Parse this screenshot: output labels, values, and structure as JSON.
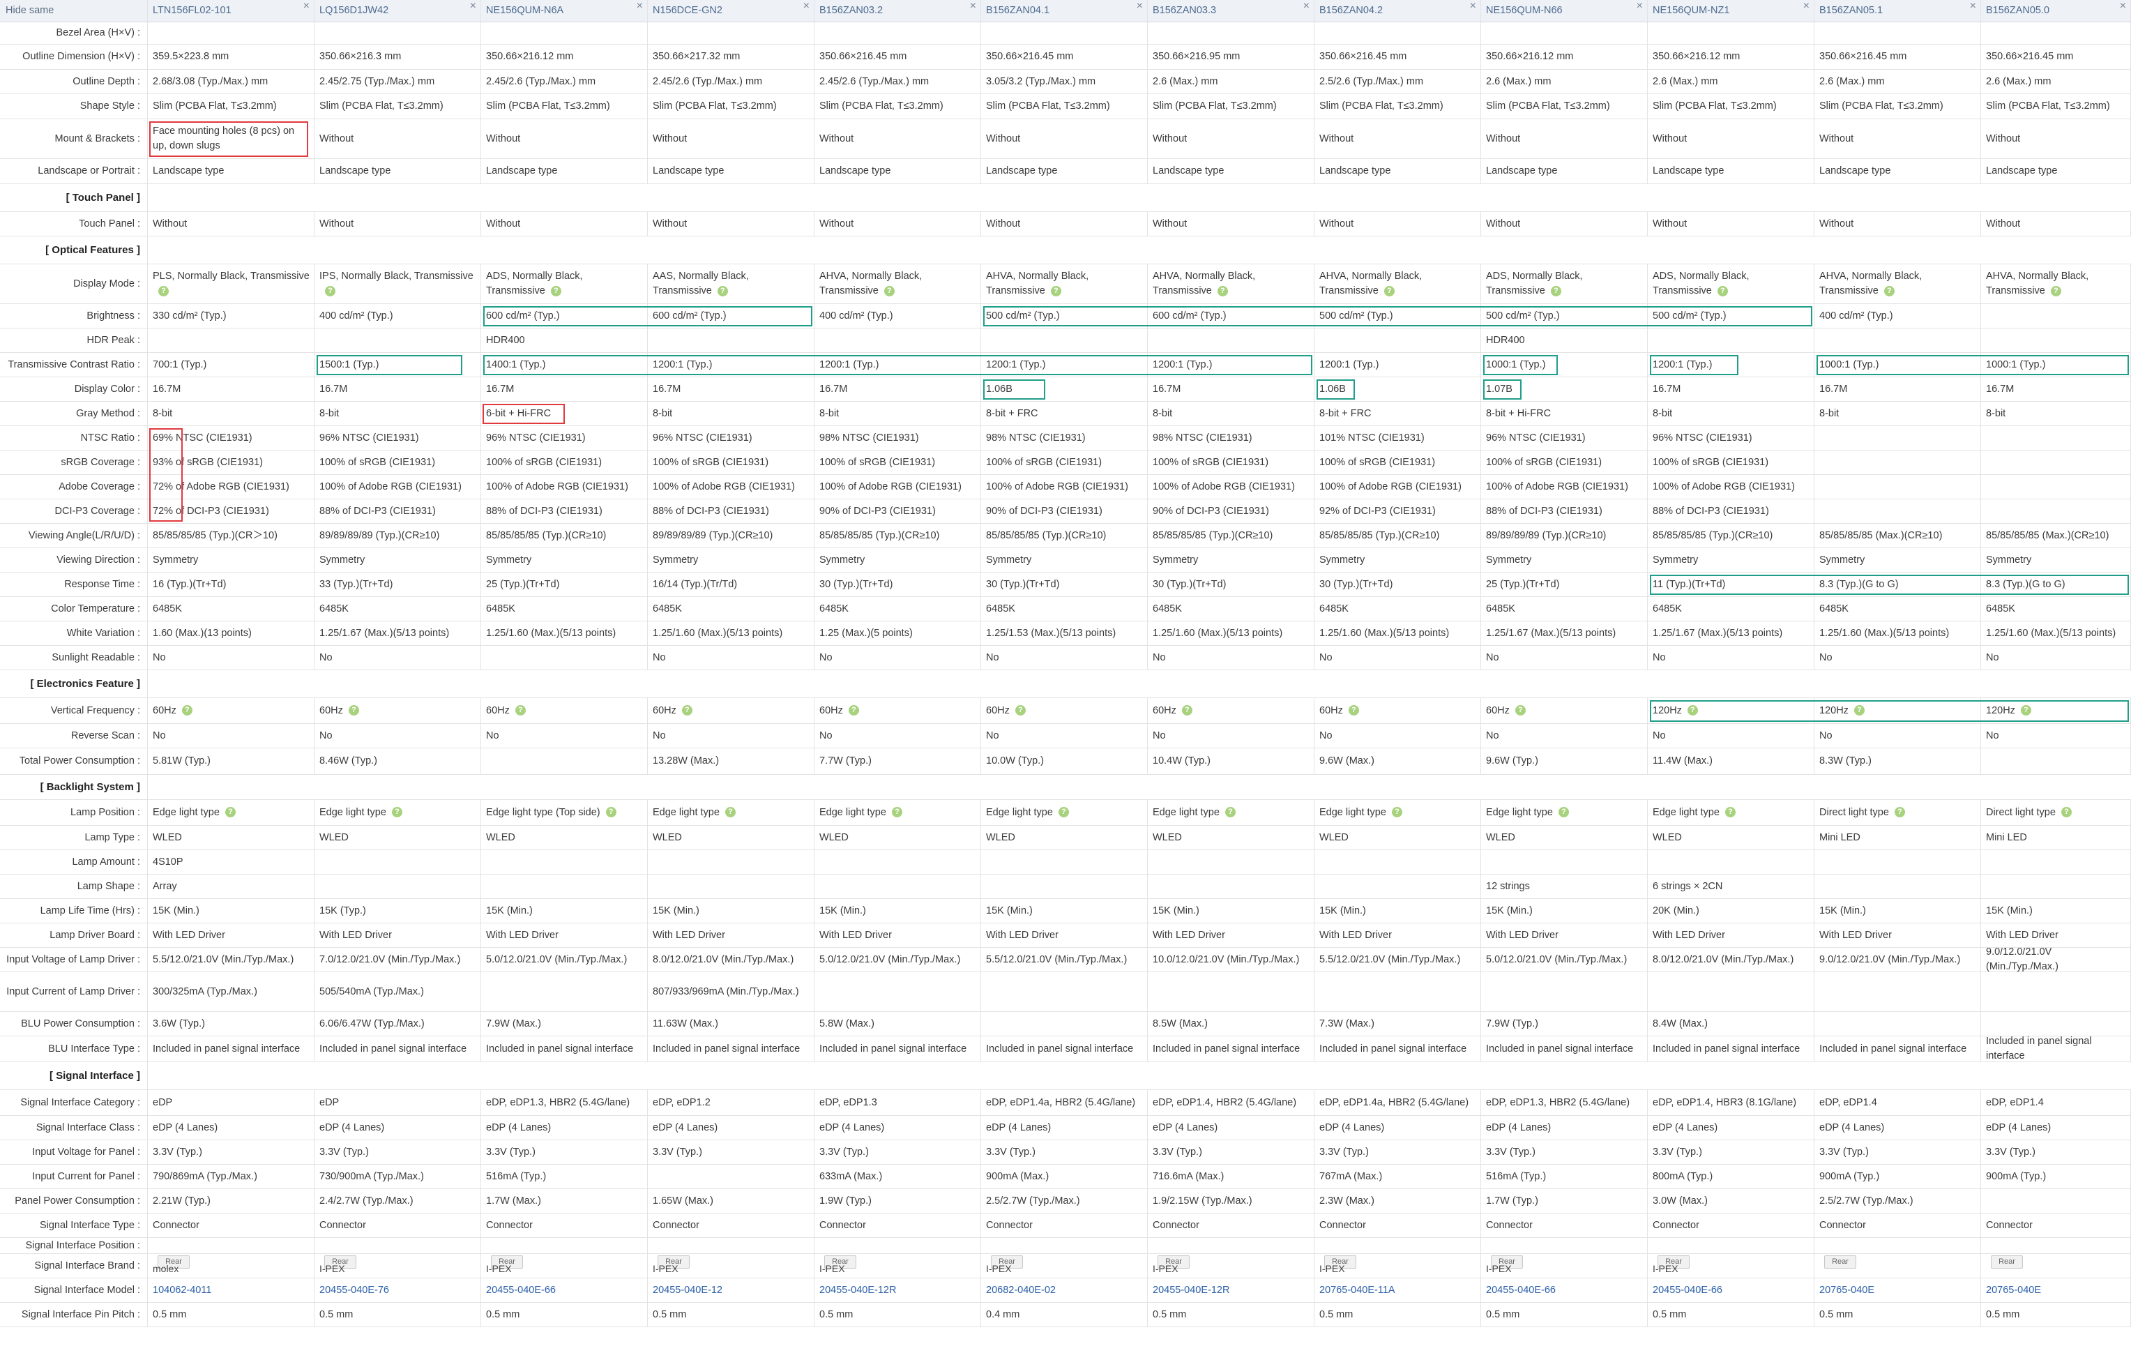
{
  "header": {
    "label": "Hide same",
    "models": [
      "LTN156FL02-101",
      "LQ156D1JW42",
      "NE156QUM-N6A",
      "N156DCE-GN2",
      "B156ZAN03.2",
      "B156ZAN04.1",
      "B156ZAN03.3",
      "B156ZAN04.2",
      "NE156QUM-N66",
      "NE156QUM-NZ1",
      "B156ZAN05.1",
      "B156ZAN05.0"
    ],
    "close_glyph": "×"
  },
  "rows": [
    {
      "label": "Bezel Area (H×V) :",
      "values": [
        "",
        "",
        "",
        "",
        "",
        "",
        "",
        "",
        "",
        "",
        "",
        ""
      ]
    },
    {
      "label": "Outline Dimension (H×V) :",
      "values": [
        "359.5×223.8 mm",
        "350.66×216.3 mm",
        "350.66×216.12 mm",
        "350.66×217.32 mm",
        "350.66×216.45 mm",
        "350.66×216.45 mm",
        "350.66×216.95 mm",
        "350.66×216.45 mm",
        "350.66×216.12 mm",
        "350.66×216.12 mm",
        "350.66×216.45 mm",
        "350.66×216.45 mm"
      ]
    },
    {
      "label": "Outline Depth :",
      "values": [
        "2.68/3.08 (Typ./Max.) mm",
        "2.45/2.75 (Typ./Max.) mm",
        "2.45/2.6 (Typ./Max.) mm",
        "2.45/2.6 (Typ./Max.) mm",
        "2.45/2.6 (Typ./Max.) mm",
        "3.05/3.2 (Typ./Max.) mm",
        "2.6 (Max.) mm",
        "2.5/2.6 (Typ./Max.) mm",
        "2.6 (Max.) mm",
        "2.6 (Max.) mm",
        "2.6 (Max.) mm",
        "2.6 (Max.) mm"
      ]
    },
    {
      "label": "Shape Style :",
      "values": [
        "Slim (PCBA Flat, T≤3.2mm)",
        "Slim (PCBA Flat, T≤3.2mm)",
        "Slim (PCBA Flat, T≤3.2mm)",
        "Slim (PCBA Flat, T≤3.2mm)",
        "Slim (PCBA Flat, T≤3.2mm)",
        "Slim (PCBA Flat, T≤3.2mm)",
        "Slim (PCBA Flat, T≤3.2mm)",
        "Slim (PCBA Flat, T≤3.2mm)",
        "Slim (PCBA Flat, T≤3.2mm)",
        "Slim (PCBA Flat, T≤3.2mm)",
        "Slim (PCBA Flat, T≤3.2mm)",
        "Slim (PCBA Flat, T≤3.2mm)"
      ]
    },
    {
      "label": "Mount & Brackets :",
      "values": [
        "Face mounting holes (8 pcs) on up, down slugs",
        "Without",
        "Without",
        "Without",
        "Without",
        "Without",
        "Without",
        "Without",
        "Without",
        "Without",
        "Without",
        "Without"
      ]
    },
    {
      "label": "Landscape or Portrait :",
      "values": [
        "Landscape type",
        "Landscape type",
        "Landscape type",
        "Landscape type",
        "Landscape type",
        "Landscape type",
        "Landscape type",
        "Landscape type",
        "Landscape type",
        "Landscape type",
        "Landscape type",
        "Landscape type"
      ]
    },
    {
      "section": "[ Touch Panel ]"
    },
    {
      "label": "Touch Panel :",
      "values": [
        "Without",
        "Without",
        "Without",
        "Without",
        "Without",
        "Without",
        "Without",
        "Without",
        "Without",
        "Without",
        "Without",
        "Without"
      ]
    },
    {
      "section": "[ Optical Features ]"
    },
    {
      "label": "Display Mode :",
      "help": true,
      "values": [
        "PLS, Normally Black, Transmissive",
        "IPS, Normally Black, Transmissive",
        "ADS, Normally Black, Transmissive",
        "AAS, Normally Black, Transmissive",
        "AHVA, Normally Black, Transmissive",
        "AHVA, Normally Black, Transmissive",
        "AHVA, Normally Black, Transmissive",
        "AHVA, Normally Black, Transmissive",
        "ADS, Normally Black, Transmissive",
        "ADS, Normally Black, Transmissive",
        "AHVA, Normally Black, Transmissive",
        "AHVA, Normally Black, Transmissive"
      ]
    },
    {
      "label": "Brightness :",
      "values": [
        "330 cd/m² (Typ.)",
        "400 cd/m² (Typ.)",
        "600 cd/m² (Typ.)",
        "600 cd/m² (Typ.)",
        "400 cd/m² (Typ.)",
        "500 cd/m² (Typ.)",
        "600 cd/m² (Typ.)",
        "500 cd/m² (Typ.)",
        "500 cd/m² (Typ.)",
        "500 cd/m² (Typ.)",
        "400 cd/m² (Typ.)",
        ""
      ]
    },
    {
      "label": "HDR Peak :",
      "values": [
        "",
        "",
        "HDR400",
        "",
        "",
        "",
        "",
        "",
        "HDR400",
        "",
        "",
        ""
      ]
    },
    {
      "label": "Transmissive Contrast Ratio :",
      "values": [
        "700:1 (Typ.)",
        "1500:1 (Typ.)",
        "1400:1 (Typ.)",
        "1200:1 (Typ.)",
        "1200:1 (Typ.)",
        "1200:1 (Typ.)",
        "1200:1 (Typ.)",
        "1200:1 (Typ.)",
        "1000:1 (Typ.)",
        "1200:1 (Typ.)",
        "1000:1 (Typ.)",
        "1000:1 (Typ.)"
      ]
    },
    {
      "label": "Display Color :",
      "values": [
        "16.7M",
        "16.7M",
        "16.7M",
        "16.7M",
        "16.7M",
        "1.06B",
        "16.7M",
        "1.06B",
        "1.07B",
        "16.7M",
        "16.7M",
        "16.7M"
      ]
    },
    {
      "label": "Gray Method :",
      "values": [
        "8-bit",
        "8-bit",
        "6-bit + Hi-FRC",
        "8-bit",
        "8-bit",
        "8-bit + FRC",
        "8-bit",
        "8-bit + FRC",
        "8-bit + Hi-FRC",
        "8-bit",
        "8-bit",
        "8-bit"
      ]
    },
    {
      "label": "NTSC Ratio :",
      "values": [
        "69% NTSC (CIE1931)",
        "96% NTSC (CIE1931)",
        "96% NTSC (CIE1931)",
        "96% NTSC (CIE1931)",
        "98% NTSC (CIE1931)",
        "98% NTSC (CIE1931)",
        "98% NTSC (CIE1931)",
        "101% NTSC (CIE1931)",
        "96% NTSC (CIE1931)",
        "96% NTSC (CIE1931)",
        "",
        ""
      ]
    },
    {
      "label": "sRGB Coverage :",
      "values": [
        "93% of sRGB (CIE1931)",
        "100% of sRGB (CIE1931)",
        "100% of sRGB (CIE1931)",
        "100% of sRGB (CIE1931)",
        "100% of sRGB (CIE1931)",
        "100% of sRGB (CIE1931)",
        "100% of sRGB (CIE1931)",
        "100% of sRGB (CIE1931)",
        "100% of sRGB (CIE1931)",
        "100% of sRGB (CIE1931)",
        "",
        ""
      ]
    },
    {
      "label": "Adobe Coverage :",
      "values": [
        "72% of Adobe RGB (CIE1931)",
        "100% of Adobe RGB (CIE1931)",
        "100% of Adobe RGB (CIE1931)",
        "100% of Adobe RGB (CIE1931)",
        "100% of Adobe RGB (CIE1931)",
        "100% of Adobe RGB (CIE1931)",
        "100% of Adobe RGB (CIE1931)",
        "100% of Adobe RGB (CIE1931)",
        "100% of Adobe RGB (CIE1931)",
        "100% of Adobe RGB (CIE1931)",
        "",
        ""
      ]
    },
    {
      "label": "DCI-P3 Coverage :",
      "values": [
        "72% of DCI-P3 (CIE1931)",
        "88% of DCI-P3 (CIE1931)",
        "88% of DCI-P3 (CIE1931)",
        "88% of DCI-P3 (CIE1931)",
        "90% of DCI-P3 (CIE1931)",
        "90% of DCI-P3 (CIE1931)",
        "90% of DCI-P3 (CIE1931)",
        "92% of DCI-P3 (CIE1931)",
        "88% of DCI-P3 (CIE1931)",
        "88% of DCI-P3 (CIE1931)",
        "",
        ""
      ]
    },
    {
      "label": "Viewing Angle(L/R/U/D) :",
      "values": [
        "85/85/85/85 (Typ.)(CR＞10)",
        "89/89/89/89 (Typ.)(CR≥10)",
        "85/85/85/85 (Typ.)(CR≥10)",
        "89/89/89/89 (Typ.)(CR≥10)",
        "85/85/85/85 (Typ.)(CR≥10)",
        "85/85/85/85 (Typ.)(CR≥10)",
        "85/85/85/85 (Typ.)(CR≥10)",
        "85/85/85/85 (Typ.)(CR≥10)",
        "89/89/89/89 (Typ.)(CR≥10)",
        "85/85/85/85 (Typ.)(CR≥10)",
        "85/85/85/85 (Max.)(CR≥10)",
        "85/85/85/85 (Max.)(CR≥10)"
      ]
    },
    {
      "label": "Viewing Direction :",
      "values": [
        "Symmetry",
        "Symmetry",
        "Symmetry",
        "Symmetry",
        "Symmetry",
        "Symmetry",
        "Symmetry",
        "Symmetry",
        "Symmetry",
        "Symmetry",
        "Symmetry",
        "Symmetry"
      ]
    },
    {
      "label": "Response Time :",
      "values": [
        "16 (Typ.)(Tr+Td)",
        "33 (Typ.)(Tr+Td)",
        "25 (Typ.)(Tr+Td)",
        "16/14 (Typ.)(Tr/Td)",
        "30 (Typ.)(Tr+Td)",
        "30 (Typ.)(Tr+Td)",
        "30 (Typ.)(Tr+Td)",
        "30 (Typ.)(Tr+Td)",
        "25 (Typ.)(Tr+Td)",
        "11 (Typ.)(Tr+Td)",
        "8.3 (Typ.)(G to G)",
        "8.3 (Typ.)(G to G)"
      ]
    },
    {
      "label": "Color Temperature :",
      "values": [
        "6485K",
        "6485K",
        "6485K",
        "6485K",
        "6485K",
        "6485K",
        "6485K",
        "6485K",
        "6485K",
        "6485K",
        "6485K",
        "6485K"
      ]
    },
    {
      "label": "White Variation :",
      "values": [
        "1.60 (Max.)(13 points)",
        "1.25/1.67 (Max.)(5/13 points)",
        "1.25/1.60 (Max.)(5/13 points)",
        "1.25/1.60 (Max.)(5/13 points)",
        "1.25 (Max.)(5 points)",
        "1.25/1.53 (Max.)(5/13 points)",
        "1.25/1.60 (Max.)(5/13 points)",
        "1.25/1.60 (Max.)(5/13 points)",
        "1.25/1.67 (Max.)(5/13 points)",
        "1.25/1.67 (Max.)(5/13 points)",
        "1.25/1.60 (Max.)(5/13 points)",
        "1.25/1.60 (Max.)(5/13 points)"
      ]
    },
    {
      "label": "Sunlight Readable :",
      "values": [
        "No",
        "No",
        "",
        "No",
        "No",
        "No",
        "No",
        "No",
        "No",
        "No",
        "No",
        "No"
      ]
    },
    {
      "section": "[ Electronics Feature ]"
    },
    {
      "label": "Vertical Frequency :",
      "help": true,
      "values": [
        "60Hz",
        "60Hz",
        "60Hz",
        "60Hz",
        "60Hz",
        "60Hz",
        "60Hz",
        "60Hz",
        "60Hz",
        "120Hz",
        "120Hz",
        "120Hz"
      ]
    },
    {
      "label": "Reverse Scan :",
      "values": [
        "No",
        "No",
        "No",
        "No",
        "No",
        "No",
        "No",
        "No",
        "No",
        "No",
        "No",
        "No"
      ]
    },
    {
      "label": "Total Power Consumption :",
      "values": [
        "5.81W (Typ.)",
        "8.46W (Typ.)",
        "",
        "13.28W (Max.)",
        "7.7W (Typ.)",
        "10.0W (Typ.)",
        "10.4W (Typ.)",
        "9.6W (Max.)",
        "9.6W (Typ.)",
        "11.4W (Max.)",
        "8.3W (Typ.)",
        ""
      ]
    },
    {
      "section": "[ Backlight System ]"
    },
    {
      "label": "Lamp Position :",
      "help": true,
      "values": [
        "Edge light type",
        "Edge light type",
        "Edge light type (Top side)",
        "Edge light type",
        "Edge light type",
        "Edge light type",
        "Edge light type",
        "Edge light type",
        "Edge light type",
        "Edge light type",
        "Direct light type",
        "Direct light type"
      ]
    },
    {
      "label": "Lamp Type :",
      "values": [
        "WLED",
        "WLED",
        "WLED",
        "WLED",
        "WLED",
        "WLED",
        "WLED",
        "WLED",
        "WLED",
        "WLED",
        "Mini LED",
        "Mini LED"
      ]
    },
    {
      "label": "Lamp Amount :",
      "values": [
        "4S10P",
        "",
        "",
        "",
        "",
        "",
        "",
        "",
        "",
        "",
        "",
        ""
      ]
    },
    {
      "label": "Lamp Shape :",
      "values": [
        "Array",
        "",
        "",
        "",
        "",
        "",
        "",
        "",
        "12 strings",
        "6 strings × 2CN",
        "",
        ""
      ]
    },
    {
      "label": "Lamp Life Time (Hrs) :",
      "values": [
        "15K (Min.)",
        "15K (Typ.)",
        "15K (Min.)",
        "15K (Min.)",
        "15K (Min.)",
        "15K (Min.)",
        "15K (Min.)",
        "15K (Min.)",
        "15K (Min.)",
        "20K (Min.)",
        "15K (Min.)",
        "15K (Min.)"
      ]
    },
    {
      "label": "Lamp Driver Board :",
      "values": [
        "With LED Driver",
        "With LED Driver",
        "With LED Driver",
        "With LED Driver",
        "With LED Driver",
        "With LED Driver",
        "With LED Driver",
        "With LED Driver",
        "With LED Driver",
        "With LED Driver",
        "With LED Driver",
        "With LED Driver"
      ]
    },
    {
      "label": "Input Voltage of Lamp Driver :",
      "values": [
        "5.5/12.0/21.0V (Min./Typ./Max.)",
        "7.0/12.0/21.0V (Min./Typ./Max.)",
        "5.0/12.0/21.0V (Min./Typ./Max.)",
        "8.0/12.0/21.0V (Min./Typ./Max.)",
        "5.0/12.0/21.0V (Min./Typ./Max.)",
        "5.5/12.0/21.0V (Min./Typ./Max.)",
        "10.0/12.0/21.0V (Min./Typ./Max.)",
        "5.5/12.0/21.0V (Min./Typ./Max.)",
        "5.0/12.0/21.0V (Min./Typ./Max.)",
        "8.0/12.0/21.0V (Min./Typ./Max.)",
        "9.0/12.0/21.0V (Min./Typ./Max.)",
        "9.0/12.0/21.0V (Min./Typ./Max.)"
      ]
    },
    {
      "label": "Input Current of Lamp Driver :",
      "values": [
        "300/325mA (Typ./Max.)",
        "505/540mA (Typ./Max.)",
        "",
        "807/933/969mA (Min./Typ./Max.)",
        "",
        "",
        "",
        "",
        "",
        "",
        "",
        ""
      ]
    },
    {
      "label": "BLU Power Consumption :",
      "values": [
        "3.6W (Typ.)",
        "6.06/6.47W (Typ./Max.)",
        "7.9W (Max.)",
        "11.63W (Max.)",
        "5.8W (Max.)",
        "",
        "8.5W (Max.)",
        "7.3W (Max.)",
        "7.9W (Typ.)",
        "8.4W (Max.)",
        "",
        ""
      ]
    },
    {
      "label": "BLU Interface Type :",
      "values": [
        "Included in panel signal interface",
        "Included in panel signal interface",
        "Included in panel signal interface",
        "Included in panel signal interface",
        "Included in panel signal interface",
        "Included in panel signal interface",
        "Included in panel signal interface",
        "Included in panel signal interface",
        "Included in panel signal interface",
        "Included in panel signal interface",
        "Included in panel signal interface",
        "Included in panel signal interface"
      ]
    },
    {
      "section": "[ Signal Interface ]"
    },
    {
      "label": "Signal Interface Category :",
      "values": [
        "eDP",
        "eDP",
        "eDP, eDP1.3, HBR2 (5.4G/lane)",
        "eDP, eDP1.2",
        "eDP, eDP1.3",
        "eDP, eDP1.4a, HBR2 (5.4G/lane)",
        "eDP, eDP1.4, HBR2 (5.4G/lane)",
        "eDP, eDP1.4a, HBR2 (5.4G/lane)",
        "eDP, eDP1.3, HBR2 (5.4G/lane)",
        "eDP, eDP1.4, HBR3 (8.1G/lane)",
        "eDP, eDP1.4",
        "eDP, eDP1.4"
      ]
    },
    {
      "label": "Signal Interface Class :",
      "values": [
        "eDP (4 Lanes)",
        "eDP (4 Lanes)",
        "eDP (4 Lanes)",
        "eDP (4 Lanes)",
        "eDP (4 Lanes)",
        "eDP (4 Lanes)",
        "eDP (4 Lanes)",
        "eDP (4 Lanes)",
        "eDP (4 Lanes)",
        "eDP (4 Lanes)",
        "eDP (4 Lanes)",
        "eDP (4 Lanes)"
      ]
    },
    {
      "label": "Input Voltage for Panel :",
      "values": [
        "3.3V (Typ.)",
        "3.3V (Typ.)",
        "3.3V (Typ.)",
        "3.3V (Typ.)",
        "3.3V (Typ.)",
        "3.3V (Typ.)",
        "3.3V (Typ.)",
        "3.3V (Typ.)",
        "3.3V (Typ.)",
        "3.3V (Typ.)",
        "3.3V (Typ.)",
        "3.3V (Typ.)"
      ]
    },
    {
      "label": "Input Current for Panel :",
      "values": [
        "790/869mA (Typ./Max.)",
        "730/900mA (Typ./Max.)",
        "516mA (Typ.)",
        "",
        "633mA (Max.)",
        "900mA (Max.)",
        "716.6mA (Max.)",
        "767mA (Max.)",
        "516mA (Typ.)",
        "800mA (Typ.)",
        "900mA (Typ.)",
        "900mA (Typ.)"
      ]
    },
    {
      "label": "Panel Power Consumption :",
      "values": [
        "2.21W (Typ.)",
        "2.4/2.7W (Typ./Max.)",
        "1.7W (Max.)",
        "1.65W (Max.)",
        "1.9W (Typ.)",
        "2.5/2.7W (Typ./Max.)",
        "1.9/2.15W (Typ./Max.)",
        "2.3W (Max.)",
        "1.7W (Typ.)",
        "3.0W (Max.)",
        "2.5/2.7W (Typ./Max.)",
        ""
      ]
    },
    {
      "label": "Signal Interface Type :",
      "values": [
        "Connector",
        "Connector",
        "Connector",
        "Connector",
        "Connector",
        "Connector",
        "Connector",
        "Connector",
        "Connector",
        "Connector",
        "Connector",
        "Connector"
      ]
    },
    {
      "label": "Signal Interface Position :",
      "values": [
        "",
        "",
        "",
        "",
        "",
        "",
        "",
        "",
        "",
        "",
        "",
        ""
      ]
    },
    {
      "label": "Signal Interface Brand :",
      "brand": true,
      "logo": "Rear",
      "values": [
        "molex",
        "I-PEX",
        "I-PEX",
        "I-PEX",
        "I-PEX",
        "I-PEX",
        "I-PEX",
        "I-PEX",
        "I-PEX",
        "I-PEX",
        "",
        ""
      ]
    },
    {
      "label": "Signal Interface Model :",
      "link": true,
      "values": [
        "104062-4011",
        "20455-040E-76",
        "20455-040E-66",
        "20455-040E-12",
        "20455-040E-12R",
        "20682-040E-02",
        "20455-040E-12R",
        "20765-040E-11A",
        "20455-040E-66",
        "20455-040E-66",
        "20765-040E",
        "20765-040E"
      ]
    },
    {
      "label": "Signal Interface Pin Pitch :",
      "values": [
        "0.5 mm",
        "0.5 mm",
        "0.5 mm",
        "0.5 mm",
        "0.5 mm",
        "0.4 mm",
        "0.5 mm",
        "0.5 mm",
        "0.5 mm",
        "0.5 mm",
        "0.5 mm",
        "0.5 mm"
      ]
    }
  ],
  "highlight_colors": {
    "red": "#e0393e",
    "green": "#1f9e8a"
  },
  "icons": {
    "help": "question-mark-circle-icon",
    "close": "close-icon"
  }
}
